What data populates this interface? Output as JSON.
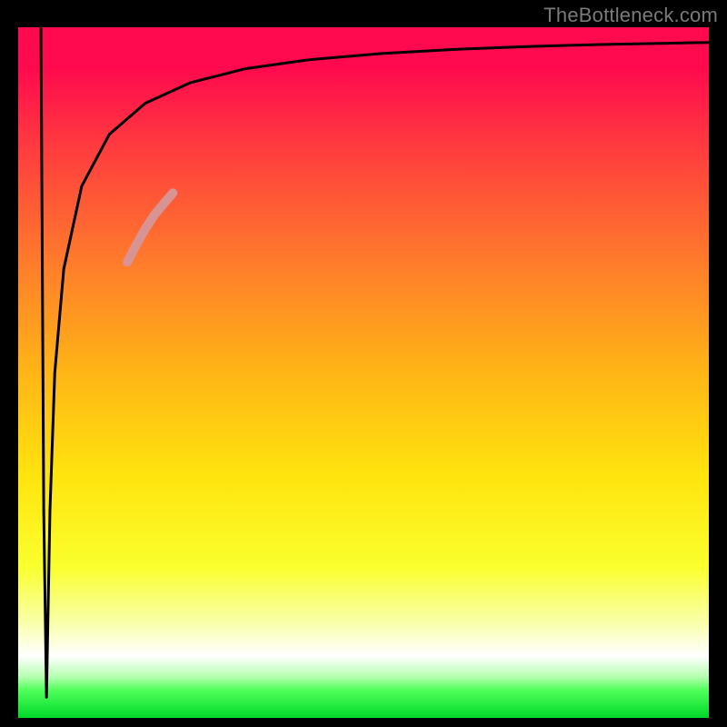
{
  "watermark": "TheBottleneck.com",
  "chart_data": {
    "type": "line",
    "title": "",
    "xlabel": "",
    "ylabel": "",
    "xlim": [
      0,
      100
    ],
    "ylim": [
      0,
      100
    ],
    "grid": false,
    "legend": false,
    "background": "vertical-gradient red→yellow→green",
    "series": [
      {
        "name": "main-curve",
        "color": "#000000",
        "stroke_width": 3,
        "x": [
          3.3,
          3.7,
          4.1,
          4.6,
          5.3,
          6.6,
          9.2,
          13.2,
          18.4,
          25.0,
          32.9,
          42.1,
          52.6,
          63.2,
          73.7,
          84.2,
          94.7,
          100.0
        ],
        "values": [
          100.0,
          30.0,
          3.0,
          30.0,
          50.0,
          65.0,
          77.0,
          84.5,
          89.0,
          92.0,
          94.0,
          95.3,
          96.2,
          96.8,
          97.2,
          97.5,
          97.7,
          97.8
        ]
      },
      {
        "name": "highlight-segment",
        "color": "#d89393",
        "stroke_width": 10,
        "x": [
          15.8,
          17.1,
          18.4,
          19.7,
          21.1,
          22.4
        ],
        "values": [
          66.0,
          68.5,
          70.8,
          72.8,
          74.5,
          76.0
        ]
      }
    ]
  }
}
